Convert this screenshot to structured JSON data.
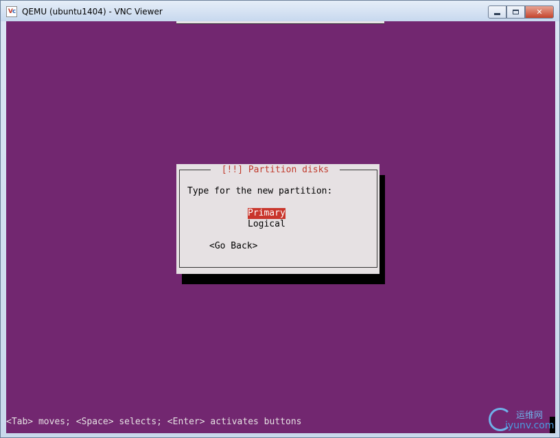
{
  "window": {
    "title": "QEMU (ubuntu1404) - VNC Viewer",
    "icon_text_a": "V",
    "icon_text_b": "c",
    "controls": {
      "minimize_icon": "minimize-icon",
      "maximize_icon": "maximize-icon",
      "close_glyph": "✕"
    }
  },
  "dialog": {
    "title": "[!!] Partition disks",
    "prompt": "Type for the new partition:",
    "options": [
      {
        "label": "Primary",
        "selected": true
      },
      {
        "label": "Logical",
        "selected": false
      }
    ],
    "go_back": "<Go Back>"
  },
  "status_line": "<Tab> moves; <Space> selects; <Enter> activates buttons",
  "watermark": {
    "chinese": "运维网",
    "domain": "iyunv.com"
  },
  "colors": {
    "console_bg": "#722770",
    "dialog_bg": "#e6e1e3",
    "dialog_title": "#c0392b",
    "selection_bg": "#c9352b"
  }
}
